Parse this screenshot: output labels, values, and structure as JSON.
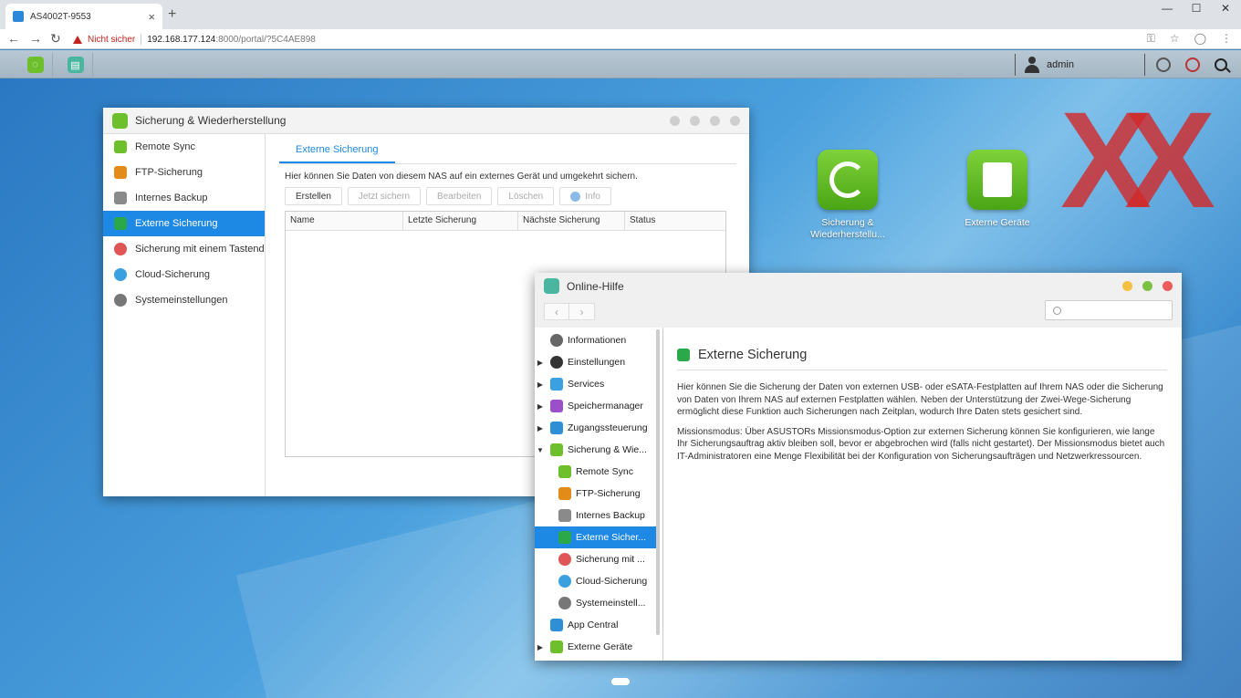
{
  "browser": {
    "tab_title": "AS4002T-9553",
    "tab_close": "×",
    "new_tab": "+",
    "not_secure": "Nicht sicher",
    "url_host": "192.168.177.124",
    "url_path": ":8000/portal/?5C4AE898",
    "win_min": "—",
    "win_max": "☐",
    "win_close": "✕"
  },
  "taskbar": {
    "username": "admin"
  },
  "desktop_icons": [
    {
      "label": "Sicherung & Wiederherstellu...",
      "color": "#6dbf2c"
    },
    {
      "label": "Externe Geräte",
      "color": "#6dbf2c"
    }
  ],
  "watermark": "XX",
  "backup_window": {
    "title": "Sicherung & Wiederherstellung",
    "sidebar": [
      {
        "label": "Remote Sync",
        "icon": "remote-sync-icon",
        "color": "#6dbf2c"
      },
      {
        "label": "FTP-Sicherung",
        "icon": "ftp-icon",
        "color": "#e38b18"
      },
      {
        "label": "Internes Backup",
        "icon": "internal-backup-icon",
        "color": "#8a8a8a"
      },
      {
        "label": "Externe Sicherung",
        "icon": "external-backup-icon",
        "color": "#2ba84a",
        "active": true
      },
      {
        "label": "Sicherung mit einem Tastendruck",
        "icon": "one-touch-icon",
        "color": "#e05555"
      },
      {
        "label": "Cloud-Sicherung",
        "icon": "cloud-icon",
        "color": "#3aa0e0"
      },
      {
        "label": "Systemeinstellungen",
        "icon": "gear-icon",
        "color": "#777777"
      }
    ],
    "tab": "Externe Sicherung",
    "description": "Hier können Sie Daten von diesem NAS auf ein externes Gerät und umgekehrt sichern.",
    "buttons": [
      "Erstellen",
      "Jetzt sichern",
      "Bearbeiten",
      "Löschen",
      "Info"
    ],
    "columns": [
      "Name",
      "Letzte Sicherung",
      "Nächste Sicherung",
      "Status"
    ]
  },
  "help_window": {
    "title": "Online-Hilfe",
    "back": "‹",
    "forward": "›",
    "tree": [
      {
        "label": "Informationen",
        "icon": "info-icon",
        "color": "#666666",
        "arrow": ""
      },
      {
        "label": "Einstellungen",
        "icon": "settings-icon",
        "color": "#333333",
        "arrow": "▶"
      },
      {
        "label": "Services",
        "icon": "services-icon",
        "color": "#3aa0e0",
        "arrow": "▶"
      },
      {
        "label": "Speichermanager",
        "icon": "storage-icon",
        "color": "#9b4fc9",
        "arrow": "▶"
      },
      {
        "label": "Zugangssteuerung",
        "icon": "access-icon",
        "color": "#2e8fd6",
        "arrow": "▶"
      },
      {
        "label": "Sicherung & Wie...",
        "icon": "backup-icon",
        "color": "#6dbf2c",
        "arrow": "▼"
      },
      {
        "label": "Remote Sync",
        "icon": "remote-sync-icon",
        "color": "#6dbf2c",
        "arrow": "",
        "child": true
      },
      {
        "label": "FTP-Sicherung",
        "icon": "ftp-icon",
        "color": "#e38b18",
        "arrow": "",
        "child": true
      },
      {
        "label": "Internes Backup",
        "icon": "internal-backup-icon",
        "color": "#8a8a8a",
        "arrow": "",
        "child": true
      },
      {
        "label": "Externe Sicher...",
        "icon": "external-backup-icon",
        "color": "#2ba84a",
        "arrow": "",
        "child": true,
        "active": true
      },
      {
        "label": "Sicherung mit ...",
        "icon": "one-touch-icon",
        "color": "#e05555",
        "arrow": "",
        "child": true
      },
      {
        "label": "Cloud-Sicherung",
        "icon": "cloud-icon",
        "color": "#3aa0e0",
        "arrow": "",
        "child": true
      },
      {
        "label": "Systemeinstell...",
        "icon": "gear-icon",
        "color": "#777777",
        "arrow": "",
        "child": true
      },
      {
        "label": "App Central",
        "icon": "app-central-icon",
        "color": "#2e8fd6",
        "arrow": ""
      },
      {
        "label": "Externe Geräte",
        "icon": "external-devices-icon",
        "color": "#6dbf2c",
        "arrow": "▶"
      }
    ],
    "content": {
      "title": "Externe Sicherung",
      "paragraph1": "Hier können Sie die Sicherung der Daten von externen USB- oder eSATA-Festplatten auf Ihrem NAS oder die Sicherung von Daten von Ihrem NAS auf externen Festplatten wählen. Neben der Unterstützung der Zwei-Wege-Sicherung ermöglicht diese Funktion auch Sicherungen nach Zeitplan, wodurch Ihre Daten stets gesichert sind.",
      "paragraph2": "Missionsmodus: Über ASUSTORs Missionsmodus-Option zur externen Sicherung können Sie konfigurieren, wie lange Ihr Sicherungsauftrag aktiv bleiben soll, bevor er abgebrochen wird (falls nicht gestartet). Der Missionsmodus bietet auch IT-Administratoren eine Menge Flexibilität bei der Konfiguration von Sicherungsaufträgen und Netzwerkressourcen."
    }
  }
}
